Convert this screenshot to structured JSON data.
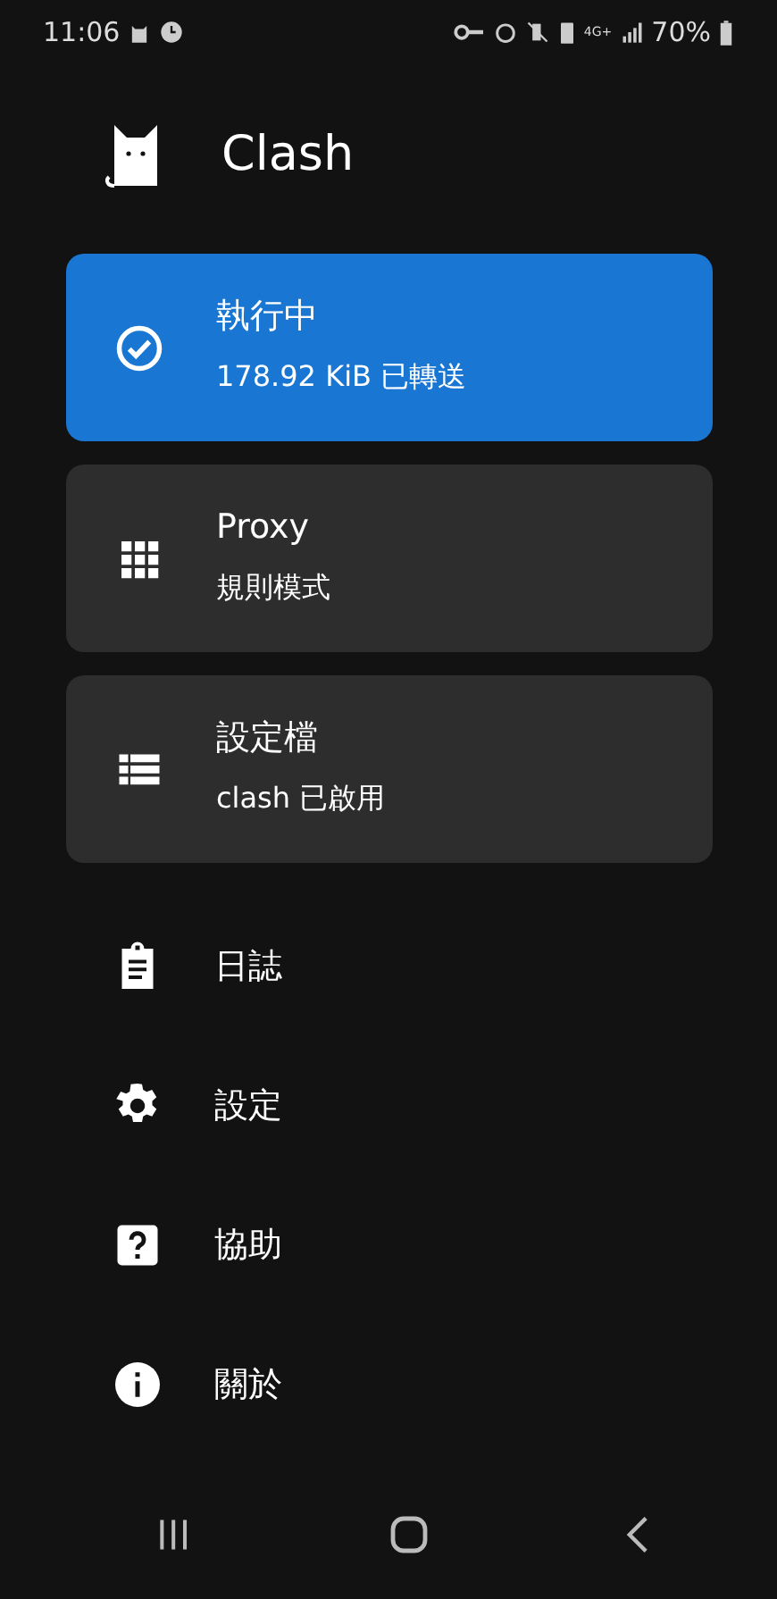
{
  "status_bar": {
    "time": "11:06",
    "battery": "70%",
    "network": "4G+"
  },
  "header": {
    "title": "Clash"
  },
  "cards": [
    {
      "kind": "status",
      "active": true,
      "title": "執行中",
      "subtitle": "178.92 KiB 已轉送"
    },
    {
      "kind": "proxy",
      "active": false,
      "title": "Proxy",
      "subtitle": "規則模式"
    },
    {
      "kind": "profile",
      "active": false,
      "title": "設定檔",
      "subtitle": "clash 已啟用"
    }
  ],
  "menu": [
    {
      "kind": "logs",
      "label": "日誌"
    },
    {
      "kind": "settings",
      "label": "設定"
    },
    {
      "kind": "help",
      "label": "協助"
    },
    {
      "kind": "about",
      "label": "關於"
    }
  ]
}
